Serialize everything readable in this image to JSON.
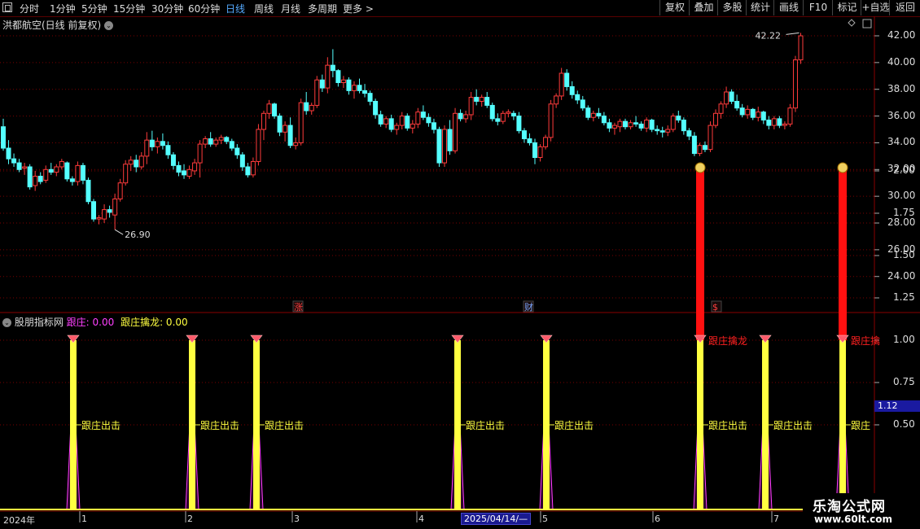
{
  "toolbar": {
    "periods": [
      "分时",
      "1分钟",
      "5分钟",
      "15分钟",
      "30分钟",
      "60分钟",
      "日线",
      "周线",
      "月线",
      "多周期",
      "更多 >"
    ],
    "active_period": "日线",
    "buttons": [
      "复权",
      "叠加",
      "多股",
      "统计",
      "画线",
      "F10",
      "+自选",
      "返回"
    ],
    "mark_label": "标记"
  },
  "main_chart": {
    "title": "洪都航空(日线 前复权)",
    "high_label": "42.22",
    "low_label": "26.90",
    "events": [
      "涨",
      "财",
      "$"
    ],
    "colors": {
      "up": "#ff3b3b",
      "down": "#54ffff"
    }
  },
  "indicator": {
    "name": "股朋指标网",
    "var1_label": "跟庄: 0.00",
    "var2_label": "跟庄擒龙: 0.00",
    "current_value": "1.12",
    "signal_label": "跟庄出击",
    "dragon_label": "跟庄擒龙",
    "truncated_label": "跟庄",
    "truncated_dragon": "跟庄擒",
    "colors": {
      "var1": "#ff40ff",
      "var2": "#ffff40"
    }
  },
  "x_axis": {
    "year_label": "2024年",
    "months": [
      "1",
      "2",
      "3",
      "4",
      "5",
      "6",
      "7"
    ],
    "cursor_date": "2025/04/14/—"
  },
  "watermark": {
    "line1": "乐淘公式网",
    "line2": "www.60lt.com"
  },
  "chart_data": [
    {
      "type": "candlestick",
      "title": "",
      "y_ticks": [
        24,
        26,
        28,
        30,
        32,
        34,
        36,
        38,
        40,
        42
      ],
      "ylim": [
        22.7,
        43.5
      ],
      "grid": true,
      "annotations": [
        {
          "text": "42.22",
          "kind": "high"
        },
        {
          "text": "26.90",
          "kind": "low"
        }
      ],
      "ohlc": [
        [
          35.2,
          35.8,
          33.4,
          33.6
        ],
        [
          33.6,
          34.2,
          32.4,
          32.8
        ],
        [
          32.8,
          33.2,
          32.2,
          32.5
        ],
        [
          32.5,
          32.8,
          31.8,
          32.0
        ],
        [
          32.1,
          32.5,
          31.6,
          32.2
        ],
        [
          32.2,
          32.4,
          30.5,
          30.7
        ],
        [
          30.8,
          31.9,
          30.4,
          31.5
        ],
        [
          31.5,
          31.8,
          30.9,
          31.1
        ],
        [
          31.2,
          32.3,
          31.0,
          32.0
        ],
        [
          32.0,
          32.5,
          31.6,
          31.8
        ],
        [
          31.8,
          32.4,
          31.5,
          32.2
        ],
        [
          32.2,
          32.8,
          32.0,
          32.6
        ],
        [
          32.5,
          32.6,
          31.1,
          31.3
        ],
        [
          31.3,
          31.5,
          30.8,
          31.1
        ],
        [
          31.1,
          32.6,
          30.8,
          32.3
        ],
        [
          32.3,
          32.5,
          30.9,
          31.2
        ],
        [
          31.2,
          31.4,
          29.4,
          29.6
        ],
        [
          29.6,
          29.8,
          28.1,
          28.3
        ],
        [
          28.3,
          28.6,
          27.9,
          28.4
        ],
        [
          28.3,
          29.4,
          28.0,
          29.0
        ],
        [
          29.0,
          29.3,
          28.4,
          28.8
        ],
        [
          28.6,
          30.2,
          27.5,
          29.8
        ],
        [
          29.8,
          31.3,
          29.6,
          31.0
        ],
        [
          31.0,
          32.7,
          30.8,
          32.4
        ],
        [
          32.4,
          33.0,
          31.9,
          32.7
        ],
        [
          32.7,
          33.1,
          31.8,
          32.2
        ],
        [
          32.2,
          33.3,
          32.0,
          33.0
        ],
        [
          33.0,
          34.8,
          32.4,
          34.2
        ],
        [
          34.2,
          34.9,
          33.4,
          33.7
        ],
        [
          33.7,
          34.4,
          33.2,
          34.1
        ],
        [
          34.1,
          34.7,
          33.5,
          33.8
        ],
        [
          33.8,
          34.1,
          32.8,
          33.1
        ],
        [
          33.1,
          33.3,
          32.0,
          32.3
        ],
        [
          32.3,
          32.6,
          31.5,
          31.8
        ],
        [
          31.9,
          32.4,
          31.3,
          31.6
        ],
        [
          31.5,
          32.3,
          31.3,
          32.0
        ],
        [
          31.9,
          32.8,
          31.6,
          32.5
        ],
        [
          32.5,
          34.2,
          31.4,
          33.9
        ],
        [
          33.9,
          34.5,
          33.6,
          34.3
        ],
        [
          34.3,
          34.8,
          33.7,
          33.9
        ],
        [
          33.9,
          34.4,
          33.7,
          34.2
        ],
        [
          34.2,
          34.6,
          33.9,
          34.4
        ],
        [
          34.4,
          34.5,
          33.9,
          34.1
        ],
        [
          34.1,
          34.3,
          33.4,
          33.6
        ],
        [
          33.6,
          33.9,
          32.8,
          33.1
        ],
        [
          33.1,
          33.3,
          31.9,
          32.2
        ],
        [
          32.2,
          32.5,
          31.4,
          31.6
        ],
        [
          31.6,
          32.9,
          31.4,
          32.6
        ],
        [
          32.6,
          35.4,
          32.3,
          35.0
        ],
        [
          35.0,
          36.4,
          34.2,
          36.2
        ],
        [
          36.2,
          37.2,
          35.8,
          36.9
        ],
        [
          36.9,
          37.0,
          35.8,
          36.0
        ],
        [
          36.0,
          36.2,
          34.5,
          34.8
        ],
        [
          34.8,
          35.6,
          34.1,
          35.3
        ],
        [
          35.3,
          35.9,
          33.6,
          33.8
        ],
        [
          33.8,
          34.4,
          33.5,
          34.0
        ],
        [
          34.0,
          37.3,
          33.8,
          37.0
        ],
        [
          37.0,
          37.8,
          36.1,
          36.4
        ],
        [
          36.4,
          37.0,
          36.1,
          36.8
        ],
        [
          36.8,
          39.0,
          36.6,
          38.7
        ],
        [
          38.7,
          39.1,
          37.8,
          38.1
        ],
        [
          38.1,
          40.4,
          37.7,
          39.8
        ],
        [
          39.8,
          41.0,
          38.9,
          39.4
        ],
        [
          39.4,
          39.5,
          38.2,
          38.5
        ],
        [
          38.5,
          39.0,
          38.1,
          38.7
        ],
        [
          38.7,
          38.9,
          37.6,
          37.9
        ],
        [
          37.9,
          38.6,
          37.3,
          38.3
        ],
        [
          38.3,
          38.8,
          37.7,
          37.9
        ],
        [
          37.9,
          38.4,
          37.4,
          37.7
        ],
        [
          37.7,
          37.9,
          36.8,
          37.1
        ],
        [
          37.1,
          37.3,
          35.8,
          36.1
        ],
        [
          36.1,
          36.4,
          35.2,
          35.4
        ],
        [
          35.4,
          36.0,
          35.1,
          35.8
        ],
        [
          35.8,
          36.1,
          34.8,
          35.0
        ],
        [
          35.0,
          35.5,
          34.6,
          35.3
        ],
        [
          35.3,
          36.3,
          35.0,
          36.0
        ],
        [
          36.0,
          36.2,
          34.9,
          35.1
        ],
        [
          35.1,
          35.7,
          34.7,
          35.4
        ],
        [
          35.4,
          36.6,
          35.1,
          36.3
        ],
        [
          36.3,
          36.8,
          35.7,
          35.9
        ],
        [
          35.9,
          36.2,
          35.2,
          35.5
        ],
        [
          35.5,
          35.8,
          34.7,
          35.0
        ],
        [
          35.0,
          35.2,
          32.2,
          32.5
        ],
        [
          32.5,
          35.3,
          32.2,
          35.0
        ],
        [
          35.0,
          35.7,
          33.1,
          33.4
        ],
        [
          33.4,
          36.6,
          33.2,
          36.2
        ],
        [
          36.2,
          36.5,
          35.6,
          35.8
        ],
        [
          35.8,
          36.4,
          35.5,
          36.1
        ],
        [
          36.1,
          37.8,
          35.7,
          37.4
        ],
        [
          37.4,
          38.0,
          36.8,
          37.1
        ],
        [
          37.1,
          37.6,
          36.7,
          37.4
        ],
        [
          37.4,
          37.8,
          36.6,
          36.8
        ],
        [
          36.8,
          37.0,
          35.6,
          35.8
        ],
        [
          35.8,
          36.2,
          35.3,
          35.6
        ],
        [
          35.6,
          36.4,
          35.4,
          36.2
        ],
        [
          36.2,
          36.5,
          35.9,
          36.3
        ],
        [
          36.2,
          36.4,
          35.7,
          36.0
        ],
        [
          36.0,
          36.3,
          34.7,
          34.9
        ],
        [
          34.9,
          35.1,
          34.0,
          34.3
        ],
        [
          34.3,
          34.7,
          33.8,
          34.0
        ],
        [
          34.0,
          34.3,
          32.4,
          32.9
        ],
        [
          32.9,
          33.9,
          32.6,
          33.7
        ],
        [
          33.7,
          34.6,
          33.5,
          34.4
        ],
        [
          34.4,
          37.2,
          34.1,
          36.9
        ],
        [
          36.9,
          37.7,
          36.6,
          37.5
        ],
        [
          37.5,
          39.6,
          37.2,
          39.2
        ],
        [
          39.2,
          39.5,
          37.9,
          38.2
        ],
        [
          38.2,
          38.6,
          37.3,
          37.6
        ],
        [
          37.6,
          37.9,
          36.9,
          37.2
        ],
        [
          37.2,
          37.5,
          36.4,
          36.6
        ],
        [
          36.6,
          36.8,
          35.7,
          35.9
        ],
        [
          35.9,
          36.4,
          35.6,
          36.2
        ],
        [
          36.2,
          36.6,
          35.8,
          36.0
        ],
        [
          36.0,
          36.3,
          35.3,
          35.5
        ],
        [
          35.5,
          35.8,
          34.8,
          35.1
        ],
        [
          35.1,
          35.5,
          34.6,
          35.3
        ],
        [
          35.2,
          35.8,
          34.8,
          35.6
        ],
        [
          35.6,
          35.8,
          35.0,
          35.2
        ],
        [
          35.2,
          35.7,
          35.0,
          35.5
        ],
        [
          35.5,
          36.0,
          35.2,
          35.4
        ],
        [
          35.4,
          35.6,
          34.9,
          35.1
        ],
        [
          35.1,
          35.9,
          34.8,
          35.7
        ],
        [
          35.7,
          35.8,
          34.8,
          35.0
        ],
        [
          35.0,
          35.3,
          34.6,
          34.9
        ],
        [
          34.9,
          35.2,
          34.4,
          34.8
        ],
        [
          34.8,
          35.3,
          34.5,
          35.0
        ],
        [
          35.0,
          36.2,
          34.8,
          36.0
        ],
        [
          36.0,
          36.4,
          35.5,
          35.7
        ],
        [
          35.7,
          35.9,
          34.6,
          34.9
        ],
        [
          34.9,
          35.1,
          34.2,
          34.5
        ],
        [
          34.5,
          34.8,
          33.0,
          33.2
        ],
        [
          33.2,
          34.0,
          33.0,
          33.8
        ],
        [
          33.8,
          34.1,
          33.3,
          33.5
        ],
        [
          33.5,
          35.6,
          33.3,
          35.3
        ],
        [
          35.3,
          36.5,
          35.1,
          36.2
        ],
        [
          36.2,
          37.1,
          35.8,
          36.9
        ],
        [
          36.9,
          38.2,
          36.6,
          37.8
        ],
        [
          37.8,
          38.0,
          36.9,
          37.1
        ],
        [
          37.1,
          37.6,
          36.4,
          36.6
        ],
        [
          36.6,
          36.9,
          35.9,
          36.1
        ],
        [
          36.1,
          36.8,
          35.8,
          36.5
        ],
        [
          36.5,
          36.6,
          35.7,
          35.9
        ],
        [
          35.9,
          36.7,
          35.6,
          36.3
        ],
        [
          36.3,
          36.4,
          35.4,
          35.7
        ],
        [
          35.7,
          36.0,
          35.0,
          35.3
        ],
        [
          35.3,
          36.0,
          35.0,
          35.8
        ],
        [
          35.8,
          36.0,
          35.1,
          35.3
        ],
        [
          35.3,
          35.6,
          35.0,
          35.4
        ],
        [
          35.4,
          36.9,
          35.2,
          36.6
        ],
        [
          36.6,
          40.5,
          36.3,
          40.2
        ],
        [
          40.2,
          42.22,
          39.9,
          42.0
        ]
      ]
    },
    {
      "type": "bar",
      "title": "",
      "y_ticks": [
        0.5,
        0.75,
        1.0,
        1.25,
        1.5,
        1.75,
        2.0
      ],
      "ylim": [
        0,
        2.2
      ],
      "series": [
        {
          "name": "跟庄",
          "kind": "signal",
          "values": [
            1,
            1,
            1,
            1,
            1,
            1,
            1,
            1,
            1
          ]
        },
        {
          "name": "跟庄擒龙",
          "kind": "dragon",
          "values": [
            0,
            0,
            0,
            0,
            0,
            2,
            0,
            0,
            2
          ]
        }
      ],
      "signal_positions": [
        0.05,
        0.16,
        0.21,
        0.39,
        0.46,
        0.55,
        0.6,
        0.65,
        0.64
      ],
      "signal_days": [
        13,
        37,
        47,
        89,
        111,
        136,
        150,
        161
      ],
      "dragon_days": [
        136,
        161
      ]
    }
  ]
}
